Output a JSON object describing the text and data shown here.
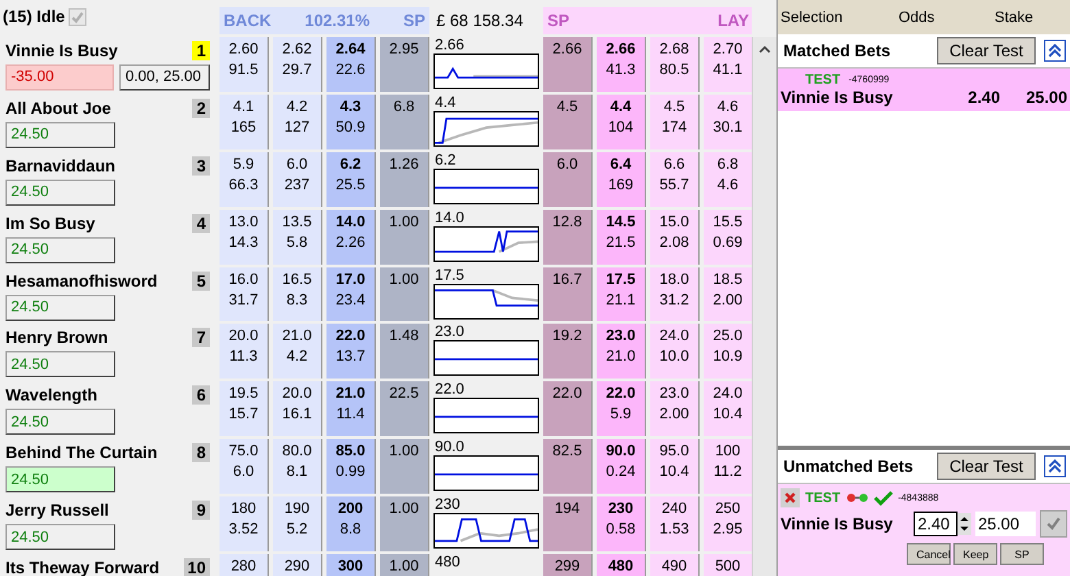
{
  "header": {
    "status": "(15) Idle",
    "checked": true,
    "back_label": "BACK",
    "book_percent": "102.31%",
    "back_sp_label": "SP",
    "balance": "£ 68 158.34",
    "lay_sp_label": "SP",
    "lay_label": "LAY"
  },
  "runners": [
    {
      "name": "Vinnie Is Busy",
      "number": "1",
      "highlighted": true,
      "pnl": {
        "text": "-35.00",
        "kind": "loss"
      },
      "selected": false,
      "stake_button": "0.00, 25.00",
      "back": [
        {
          "price": "2.60",
          "size": "91.5"
        },
        {
          "price": "2.62",
          "size": "29.7"
        },
        {
          "price": "2.64",
          "size": "22.6"
        }
      ],
      "back_sp": "2.95",
      "trend": {
        "label": "2.66",
        "kind": "spike"
      },
      "lay_sp": "2.66",
      "lay": [
        {
          "price": "2.66",
          "size": "41.3"
        },
        {
          "price": "2.68",
          "size": "80.5"
        },
        {
          "price": "2.70",
          "size": "41.1"
        }
      ]
    },
    {
      "name": "All About Joe",
      "number": "2",
      "highlighted": false,
      "pnl": {
        "text": "24.50",
        "kind": "profit"
      },
      "selected": false,
      "back": [
        {
          "price": "4.1",
          "size": "165"
        },
        {
          "price": "4.2",
          "size": "127"
        },
        {
          "price": "4.3",
          "size": "50.9"
        }
      ],
      "back_sp": "6.8",
      "trend": {
        "label": "4.4",
        "kind": "rise"
      },
      "lay_sp": "4.5",
      "lay": [
        {
          "price": "4.4",
          "size": "104"
        },
        {
          "price": "4.5",
          "size": "174"
        },
        {
          "price": "4.6",
          "size": "30.1"
        }
      ]
    },
    {
      "name": "Barnaviddaun",
      "number": "3",
      "highlighted": false,
      "pnl": {
        "text": "24.50",
        "kind": "profit"
      },
      "selected": false,
      "back": [
        {
          "price": "5.9",
          "size": "66.3"
        },
        {
          "price": "6.0",
          "size": "237"
        },
        {
          "price": "6.2",
          "size": "25.5"
        }
      ],
      "back_sp": "1.26",
      "trend": {
        "label": "6.2",
        "kind": "flat"
      },
      "lay_sp": "6.0",
      "lay": [
        {
          "price": "6.4",
          "size": "169"
        },
        {
          "price": "6.6",
          "size": "55.7"
        },
        {
          "price": "6.8",
          "size": "4.6"
        }
      ]
    },
    {
      "name": "Im So Busy",
      "number": "4",
      "highlighted": false,
      "pnl": {
        "text": "24.50",
        "kind": "profit"
      },
      "selected": false,
      "back": [
        {
          "price": "13.0",
          "size": "14.3"
        },
        {
          "price": "13.5",
          "size": "5.8"
        },
        {
          "price": "14.0",
          "size": "2.26"
        }
      ],
      "back_sp": "1.00",
      "trend": {
        "label": "14.0",
        "kind": "jump"
      },
      "lay_sp": "12.8",
      "lay": [
        {
          "price": "14.5",
          "size": "21.5"
        },
        {
          "price": "15.0",
          "size": "2.08"
        },
        {
          "price": "15.5",
          "size": "0.69"
        }
      ]
    },
    {
      "name": "Hesamanofhisword",
      "number": "5",
      "highlighted": false,
      "pnl": {
        "text": "24.50",
        "kind": "profit"
      },
      "selected": false,
      "back": [
        {
          "price": "16.0",
          "size": "31.7"
        },
        {
          "price": "16.5",
          "size": "8.3"
        },
        {
          "price": "17.0",
          "size": "23.4"
        }
      ],
      "back_sp": "1.00",
      "trend": {
        "label": "17.5",
        "kind": "drop"
      },
      "lay_sp": "16.7",
      "lay": [
        {
          "price": "17.5",
          "size": "21.1"
        },
        {
          "price": "18.0",
          "size": "31.2"
        },
        {
          "price": "18.5",
          "size": "2.00"
        }
      ]
    },
    {
      "name": "Henry Brown",
      "number": "7",
      "highlighted": false,
      "pnl": {
        "text": "24.50",
        "kind": "profit"
      },
      "selected": false,
      "back": [
        {
          "price": "20.0",
          "size": "11.3"
        },
        {
          "price": "21.0",
          "size": "4.2"
        },
        {
          "price": "22.0",
          "size": "13.7"
        }
      ],
      "back_sp": "1.48",
      "trend": {
        "label": "23.0",
        "kind": "flat"
      },
      "lay_sp": "19.2",
      "lay": [
        {
          "price": "23.0",
          "size": "21.0"
        },
        {
          "price": "24.0",
          "size": "10.0"
        },
        {
          "price": "25.0",
          "size": "10.9"
        }
      ]
    },
    {
      "name": "Wavelength",
      "number": "6",
      "highlighted": false,
      "pnl": {
        "text": "24.50",
        "kind": "profit"
      },
      "selected": false,
      "back": [
        {
          "price": "19.5",
          "size": "15.7"
        },
        {
          "price": "20.0",
          "size": "16.1"
        },
        {
          "price": "21.0",
          "size": "11.4"
        }
      ],
      "back_sp": "22.5",
      "trend": {
        "label": "22.0",
        "kind": "flat"
      },
      "lay_sp": "22.0",
      "lay": [
        {
          "price": "22.0",
          "size": "5.9"
        },
        {
          "price": "23.0",
          "size": "2.00"
        },
        {
          "price": "24.0",
          "size": "10.4"
        }
      ]
    },
    {
      "name": "Behind The Curtain",
      "number": "8",
      "highlighted": false,
      "pnl": {
        "text": "24.50",
        "kind": "profit"
      },
      "selected": true,
      "back": [
        {
          "price": "75.0",
          "size": "6.0"
        },
        {
          "price": "80.0",
          "size": "8.1"
        },
        {
          "price": "85.0",
          "size": "0.99"
        }
      ],
      "back_sp": "1.00",
      "trend": {
        "label": "90.0",
        "kind": "flat"
      },
      "lay_sp": "82.5",
      "lay": [
        {
          "price": "90.0",
          "size": "0.24"
        },
        {
          "price": "95.0",
          "size": "10.4"
        },
        {
          "price": "100",
          "size": "11.2"
        }
      ]
    },
    {
      "name": "Jerry Russell",
      "number": "9",
      "highlighted": false,
      "pnl": {
        "text": "24.50",
        "kind": "profit"
      },
      "selected": false,
      "back": [
        {
          "price": "180",
          "size": "3.52"
        },
        {
          "price": "190",
          "size": "5.2"
        },
        {
          "price": "200",
          "size": "8.8"
        }
      ],
      "back_sp": "1.00",
      "trend": {
        "label": "230",
        "kind": "pulses"
      },
      "lay_sp": "194",
      "lay": [
        {
          "price": "230",
          "size": "0.58"
        },
        {
          "price": "240",
          "size": "1.53"
        },
        {
          "price": "250",
          "size": "2.95"
        }
      ]
    },
    {
      "name": "Its Theway Forward",
      "number": "10",
      "highlighted": false,
      "selected": false,
      "back": [
        {
          "price": "280"
        },
        {
          "price": "290"
        },
        {
          "price": "300"
        }
      ],
      "back_sp": "1.00",
      "trend": {
        "label": "480"
      },
      "lay_sp": "299",
      "lay": [
        {
          "price": "480"
        },
        {
          "price": "490"
        },
        {
          "price": "500"
        }
      ]
    }
  ],
  "bet_panel": {
    "columns": [
      "Selection",
      "Odds",
      "Stake"
    ],
    "matched": {
      "title": "Matched Bets",
      "button": "Clear Test",
      "bets": [
        {
          "tag": "TEST",
          "ref": "-4760999",
          "selection": "Vinnie Is Busy",
          "odds": "2.40",
          "stake": "25.00"
        }
      ]
    },
    "unmatched": {
      "title": "Unmatched Bets",
      "button": "Clear Test",
      "bets": [
        {
          "tag": "TEST",
          "ref": "-4843888",
          "selection": "Vinnie Is Busy",
          "odds": "2.40",
          "stake": "25.00",
          "actions": [
            "Cancel",
            "Keep",
            "SP"
          ]
        }
      ]
    }
  }
}
